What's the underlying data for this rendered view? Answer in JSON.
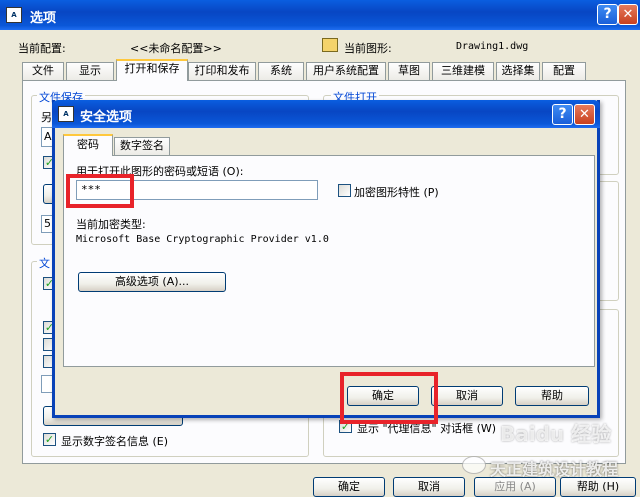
{
  "outer": {
    "title": "选项",
    "profile_label": "当前配置:",
    "profile_value": "<<未命名配置>>",
    "drawing_label": "当前图形:",
    "drawing_value": "Drawing1.dwg",
    "tabs": [
      "文件",
      "显示",
      "打开和保存",
      "打印和发布",
      "系统",
      "用户系统配置",
      "草图",
      "三维建模",
      "选择集",
      "配置"
    ],
    "group_save_title": "文件保存",
    "group_open_title": "文件打开",
    "partial_save_as": "另",
    "partial_letter": "A",
    "partial_five": "5",
    "partial_group3": "文",
    "show_sig_label": "显示数字签名信息 (E)",
    "show_proxy_label": "显示 \"代理信息\" 对话框 (W)",
    "ok": "确定",
    "cancel": "取消",
    "apply": "应用 (A)",
    "help": "帮助 (H)"
  },
  "dialog": {
    "title": "安全选项",
    "tabs": [
      "密码",
      "数字签名"
    ],
    "password_label": "用于打开此图形的密码或短语 (O):",
    "password_value": "***",
    "encrypt_props_label": "加密图形特性 (P)",
    "enc_type_label": "当前加密类型:",
    "enc_type_value": "Microsoft Base Cryptographic Provider v1.0",
    "advanced_button": "高级选项 (A)...",
    "ok": "确定",
    "cancel": "取消",
    "help": "帮助"
  },
  "watermark": {
    "baidu": "Baidu 经验",
    "channel": "天正建筑设计教程"
  },
  "icons": {
    "outer_app": "autocad-app-icon",
    "dialog_app": "autocad-app-icon",
    "drawing": "drawing-file-icon",
    "help": "question-mark-icon",
    "close": "close-x-icon"
  }
}
